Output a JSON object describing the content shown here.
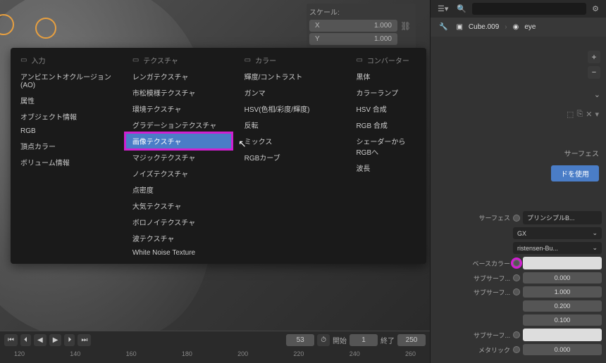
{
  "scale": {
    "label": "スケール:",
    "x_key": "X",
    "x_val": "1.000",
    "y_key": "Y",
    "y_val": "1.000"
  },
  "menu": {
    "col1": {
      "header": "入力",
      "items": [
        "アンビエントオクルージョン(AO)",
        "属性",
        "オブジェクト情報",
        "RGB",
        "頂点カラー",
        "ボリューム情報"
      ]
    },
    "col2": {
      "header": "テクスチャ",
      "items": [
        "レンガテクスチャ",
        "市松模様テクスチャ",
        "環境テクスチャ",
        "グラデーションテクスチャ",
        "画像テクスチャ",
        "マジックテクスチャ",
        "ノイズテクスチャ",
        "点密度",
        "大気テクスチャ",
        "ボロノイテクスチャ",
        "波テクスチャ",
        "White Noise Texture"
      ],
      "highlighted": 4
    },
    "col3": {
      "header": "カラー",
      "items": [
        "輝度/コントラスト",
        "ガンマ",
        "HSV(色相/彩度/輝度)",
        "反転",
        "ミックス",
        "RGBカーブ"
      ]
    },
    "col4": {
      "header": "コンバーター",
      "items": [
        "黒体",
        "カラーランプ",
        "HSV 合成",
        "RGB 合成",
        "シェーダーからRGBへ",
        "波長"
      ]
    }
  },
  "timeline": {
    "frame": "53",
    "start_label": "開始",
    "start": "1",
    "end_label": "終了",
    "end": "250",
    "ticks": [
      "120",
      "140",
      "160",
      "180",
      "200",
      "220",
      "240",
      "260"
    ]
  },
  "outliner": {
    "obj": "Cube.009",
    "mat": "eye"
  },
  "surface": {
    "header": "サーフェス",
    "use_btn": "ドを使用"
  },
  "props": {
    "surface": {
      "label": "サーフェス",
      "value": "プリンシプルB..."
    },
    "dist1": {
      "value": "GX"
    },
    "dist2": {
      "value": "ristensen-Bu..."
    },
    "base_color": {
      "label": "ベースカラー"
    },
    "subsurf1": {
      "label": "サブサーフ...",
      "value": "0.000"
    },
    "subsurf2": {
      "label": "サブサーフ...",
      "v1": "1.000",
      "v2": "0.200",
      "v3": "0.100"
    },
    "subsurf3": {
      "label": "サブサーフ..."
    },
    "metallic": {
      "label": "メタリック",
      "value": "0.000"
    }
  }
}
